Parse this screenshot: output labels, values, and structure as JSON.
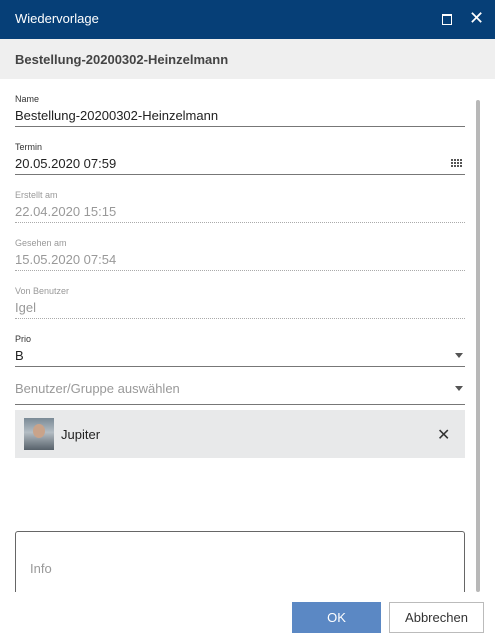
{
  "window": {
    "title": "Wiedervorlage"
  },
  "header": {
    "document_title": "Bestellung-20200302-Heinzelmann"
  },
  "fields": {
    "name": {
      "label": "Name",
      "value": "Bestellung-20200302-Heinzelmann"
    },
    "termin": {
      "label": "Termin",
      "value": "20.05.2020 07:59"
    },
    "erstellt": {
      "label": "Erstellt am",
      "value": "22.04.2020 15:15"
    },
    "gesehen": {
      "label": "Gesehen am",
      "value": "15.05.2020 07:54"
    },
    "von_benutzer": {
      "label": "Von Benutzer",
      "value": "Igel"
    },
    "prio": {
      "label": "Prio",
      "value": "B"
    },
    "benutzer_gruppe": {
      "placeholder": "Benutzer/Gruppe auswählen"
    }
  },
  "recipients": [
    {
      "name": "Jupiter"
    }
  ],
  "info": {
    "placeholder": "Info"
  },
  "buttons": {
    "ok": "OK",
    "cancel": "Abbrechen"
  },
  "icons": {
    "maximize": "maximize-icon",
    "close": "close-icon",
    "calendar": "calendar-grid-icon",
    "dropdown": "chevron-down-icon",
    "remove": "close-icon"
  },
  "colors": {
    "titlebar": "#063f77",
    "primary_button": "#5b88c4",
    "chip_bg": "#e8e9ea"
  }
}
